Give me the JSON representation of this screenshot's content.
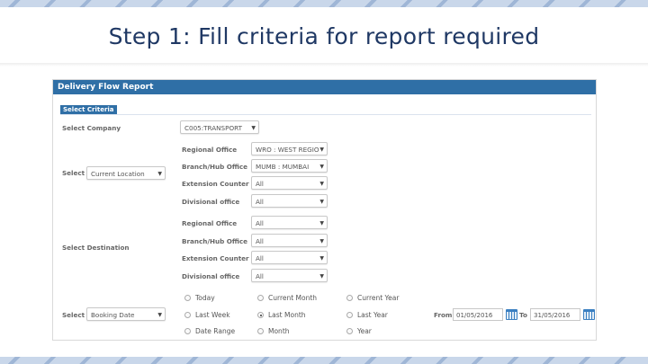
{
  "slide": {
    "title": "Step 1: Fill criteria for report required"
  },
  "panel": {
    "header": "Delivery Flow Report",
    "criteria_tab": "Select Criteria"
  },
  "company": {
    "label": "Select Company",
    "value": "C005:TRANSPORT"
  },
  "location": {
    "label": "Select",
    "value": "Current Location"
  },
  "origin_fields": [
    {
      "label": "Regional Office",
      "value": "WRO : WEST REGIO"
    },
    {
      "label": "Branch/Hub Office",
      "value": "MUMB : MUMBAI"
    },
    {
      "label": "Extension Counter",
      "value": "All"
    },
    {
      "label": "Divisional office",
      "value": "All"
    }
  ],
  "destination": {
    "label": "Select Destination"
  },
  "destination_fields": [
    {
      "label": "Regional Office",
      "value": "All"
    },
    {
      "label": "Branch/Hub Office",
      "value": "All"
    },
    {
      "label": "Extension Counter",
      "value": "All"
    },
    {
      "label": "Divisional office",
      "value": "All"
    }
  ],
  "date_filter": {
    "label": "Select",
    "value": "Booking Date"
  },
  "periods": {
    "today": "Today",
    "current_month": "Current Month",
    "current_year": "Current Year",
    "last_week": "Last Week",
    "last_month": "Last Month",
    "last_year": "Last Year",
    "date_range": "Date Range",
    "month": "Month",
    "year": "Year",
    "selected": "last_month"
  },
  "range": {
    "from_label": "From :",
    "from_value": "01/05/2016",
    "to_label": "To :",
    "to_value": "31/05/2016"
  }
}
